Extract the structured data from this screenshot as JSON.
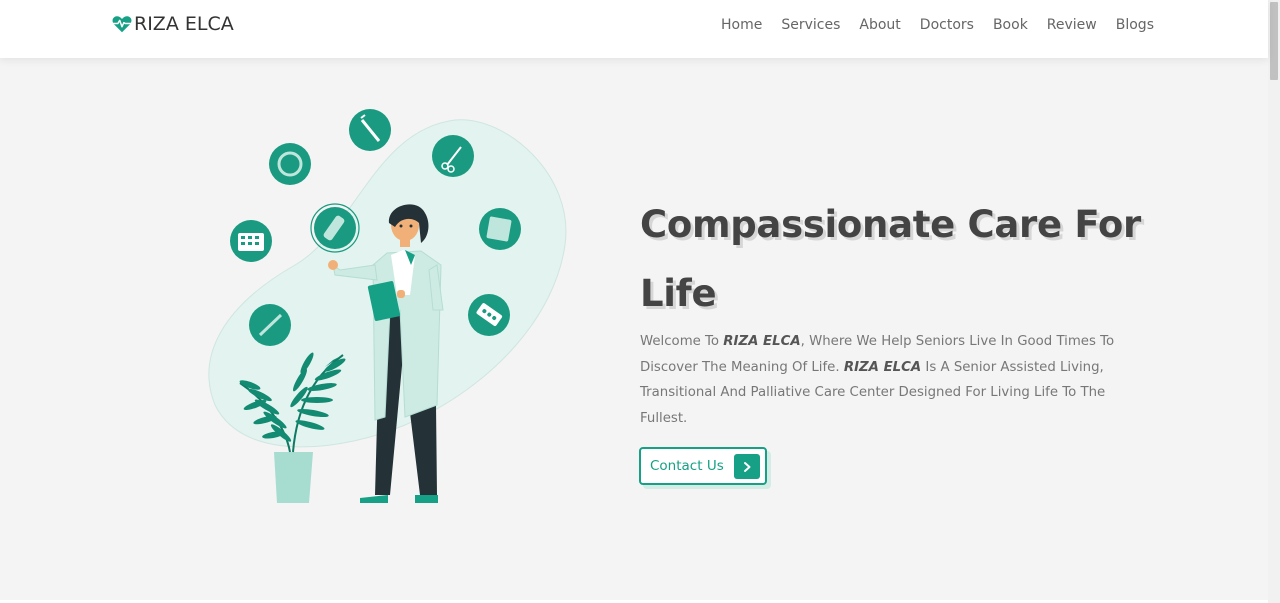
{
  "brand": {
    "name": "RIZA ELCA",
    "accent_color": "#16a085",
    "logo_icon": "heart-pulse-icon"
  },
  "nav": {
    "items": [
      "Home",
      "Services",
      "About",
      "Doctors",
      "Book",
      "Review",
      "Blogs"
    ]
  },
  "hero": {
    "title_line1": "Compassionate Care For",
    "title_line2": "Life",
    "description": {
      "part1": "Welcome To ",
      "brand1": "RIZA ELCA",
      "part2": ", Where We Help Seniors Live In Good Times To Discover The Meaning Of Life. ",
      "brand2": "RIZA ELCA",
      "part3": " Is A Senior Assisted Living, Transitional And Palliative Care Center Designed For Living Life To The Fullest."
    },
    "cta_label": "Contact Us",
    "cta_icon": "chevron-right-icon"
  },
  "illustration": {
    "icons": [
      "syringe-icon",
      "scissors-icon",
      "ring-icon",
      "vial-icon",
      "pill-pack-icon",
      "calendar-pills-icon",
      "thermometer-icon",
      "tablet-strip-icon"
    ]
  }
}
